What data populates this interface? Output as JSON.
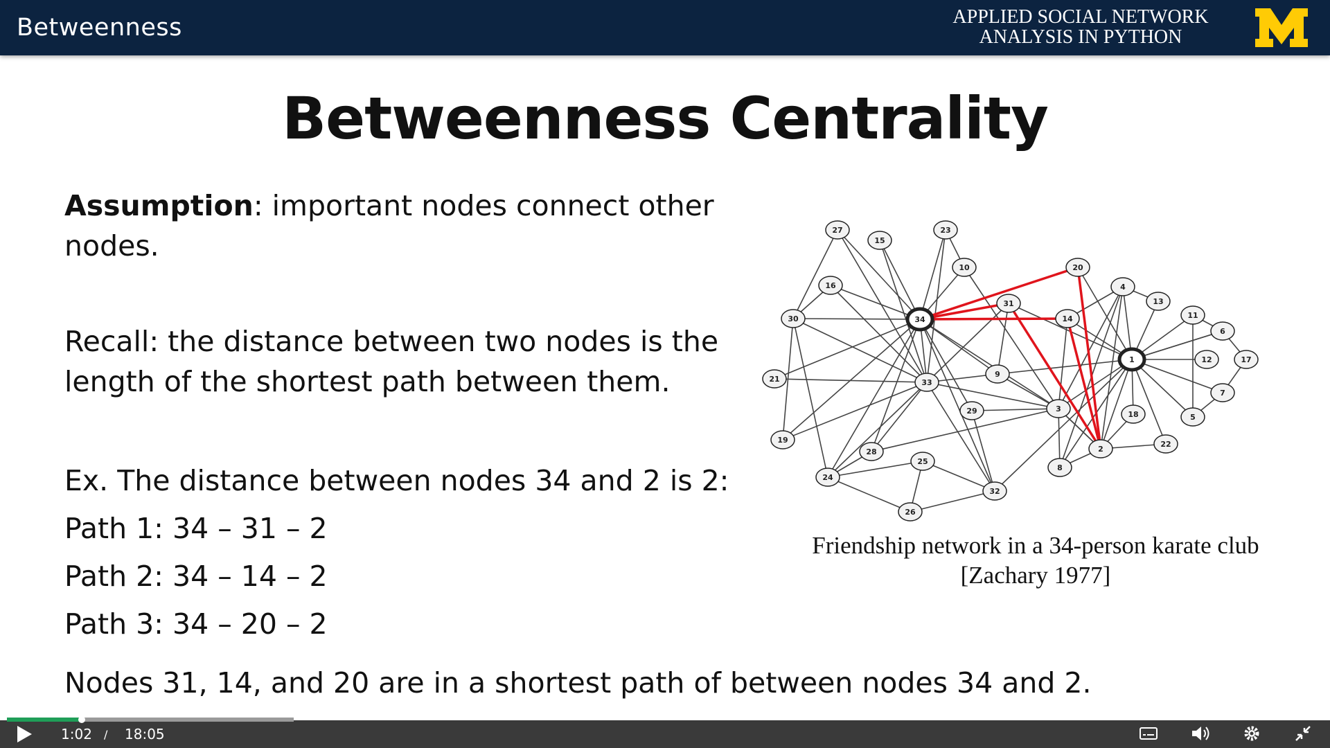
{
  "header": {
    "title": "Betweenness",
    "course_line1": "APPLIED SOCIAL NETWORK",
    "course_line2": "ANALYSIS IN PYTHON",
    "logo_letter": "M",
    "logo_color": "#ffcb05",
    "background": "#0c2340"
  },
  "slide": {
    "title": "Betweenness Centrality",
    "assumption_label": "Assumption",
    "assumption_text_line1": ": important nodes connect other",
    "assumption_text_line2": "nodes.",
    "recall_line1": "Recall: the distance between two nodes is the",
    "recall_line2": "length of the shortest path between them.",
    "example_line": "Ex. The distance between nodes 34 and 2 is 2:",
    "paths": [
      "Path 1: 34 – 31 – 2",
      "Path 2: 34 – 14 – 2",
      "Path 3: 34 – 20 – 2"
    ],
    "conclusion": "Nodes 31, 14, and 20 are in a shortest path of between nodes 34 and 2.",
    "caption_line1": "Friendship network in a 34-person karate club",
    "caption_line2": "[Zachary 1977]",
    "highlight_color": "#e0141c"
  },
  "network": {
    "nodes": [
      "1",
      "2",
      "3",
      "4",
      "5",
      "6",
      "7",
      "8",
      "9",
      "10",
      "11",
      "12",
      "13",
      "14",
      "15",
      "16",
      "17",
      "18",
      "19",
      "20",
      "21",
      "22",
      "23",
      "24",
      "25",
      "26",
      "27",
      "28",
      "29",
      "30",
      "31",
      "32",
      "33",
      "34"
    ],
    "highlighted_paths": [
      [
        "34",
        "31",
        "2"
      ],
      [
        "34",
        "14",
        "2"
      ],
      [
        "34",
        "20",
        "2"
      ]
    ]
  },
  "player": {
    "current_time": "1:02",
    "separator": "/",
    "duration": "18:05",
    "progress_fraction": 0.057,
    "buffered_fraction": 0.218,
    "play_icon": "play-icon",
    "captions_icon": "captions-icon",
    "volume_icon": "volume-icon",
    "settings_icon": "gear-icon",
    "exit_fullscreen_icon": "exit-fullscreen-icon"
  }
}
